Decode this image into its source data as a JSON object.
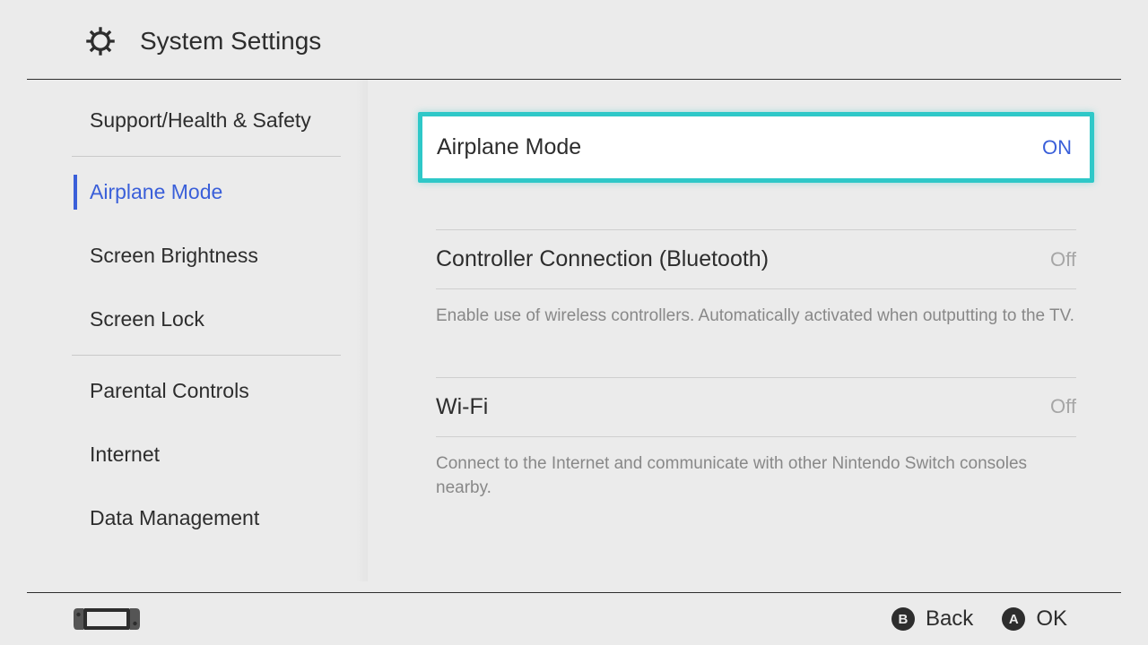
{
  "header": {
    "title": "System Settings"
  },
  "sidebar": {
    "items": [
      {
        "label": "Support/Health & Safety"
      },
      {
        "label": "Airplane Mode"
      },
      {
        "label": "Screen Brightness"
      },
      {
        "label": "Screen Lock"
      },
      {
        "label": "Parental Controls"
      },
      {
        "label": "Internet"
      },
      {
        "label": "Data Management"
      }
    ]
  },
  "main": {
    "airplane": {
      "label": "Airplane Mode",
      "value": "ON"
    },
    "bluetooth": {
      "label": "Controller Connection (Bluetooth)",
      "value": "Off",
      "description": "Enable use of wireless controllers. Automatically activated when outputting to the TV."
    },
    "wifi": {
      "label": "Wi-Fi",
      "value": "Off",
      "description": "Connect to the Internet and communicate with other Nintendo Switch consoles nearby."
    }
  },
  "footer": {
    "back": {
      "button": "B",
      "label": "Back"
    },
    "ok": {
      "button": "A",
      "label": "OK"
    }
  }
}
